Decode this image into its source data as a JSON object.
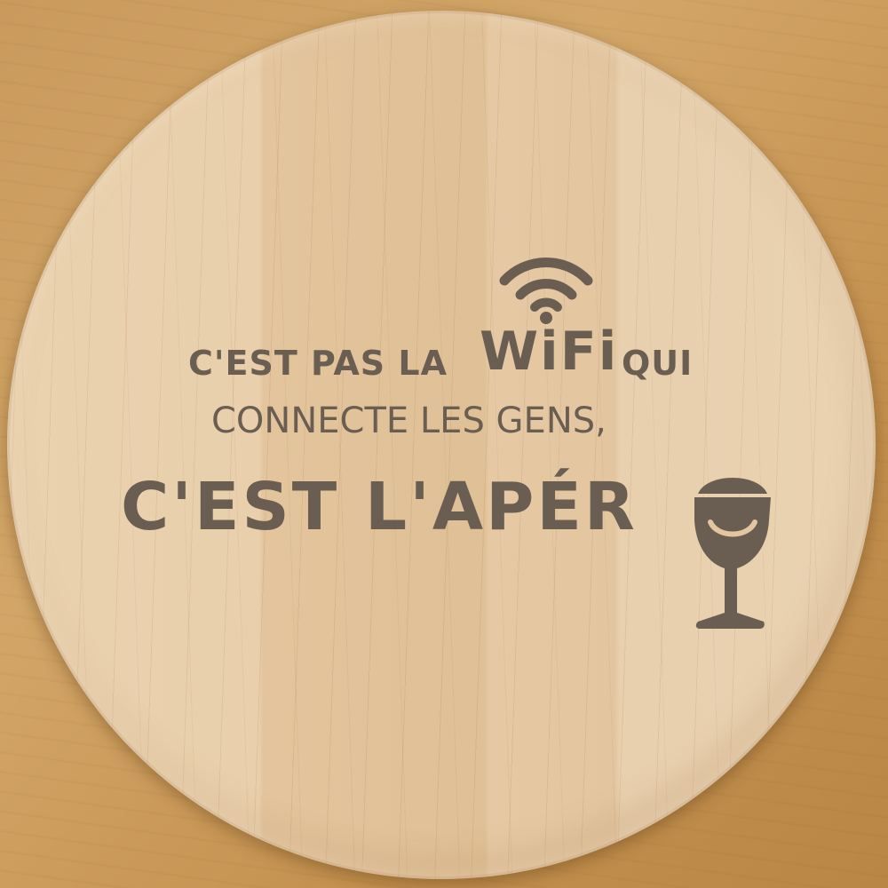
{
  "coaster": {
    "line1_start": "C'EST PAS LA",
    "line1_highlight": "WiFi",
    "line1_end": "QUI",
    "line2": "CONNECTE LES GENS,",
    "line3": "C'EST L'APÉR"
  },
  "icons": [
    "wifi-icon",
    "wine-glass-icon"
  ],
  "colors": {
    "engraving": "#6a5e53",
    "wood_light": "#ead2af",
    "table": "#c99a5c"
  }
}
